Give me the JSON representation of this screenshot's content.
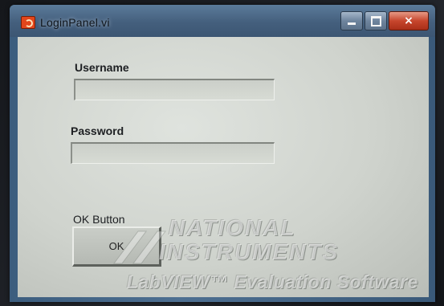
{
  "window": {
    "title": "LoginPanel.vi",
    "close_symbol": "×",
    "icons": {
      "app": "labview-icon",
      "minimize": "minimize-icon",
      "maximize": "maximize-icon",
      "close": "close-icon"
    }
  },
  "form": {
    "username_label": "Username",
    "username_value": "",
    "password_label": "Password",
    "password_value": "",
    "ok_caption": "OK Button",
    "ok_text": "OK"
  },
  "watermark": {
    "line1": "NATIONAL",
    "line2": "INSTRUMENTS",
    "line3": "LabVIEW™ Evaluation Software"
  }
}
